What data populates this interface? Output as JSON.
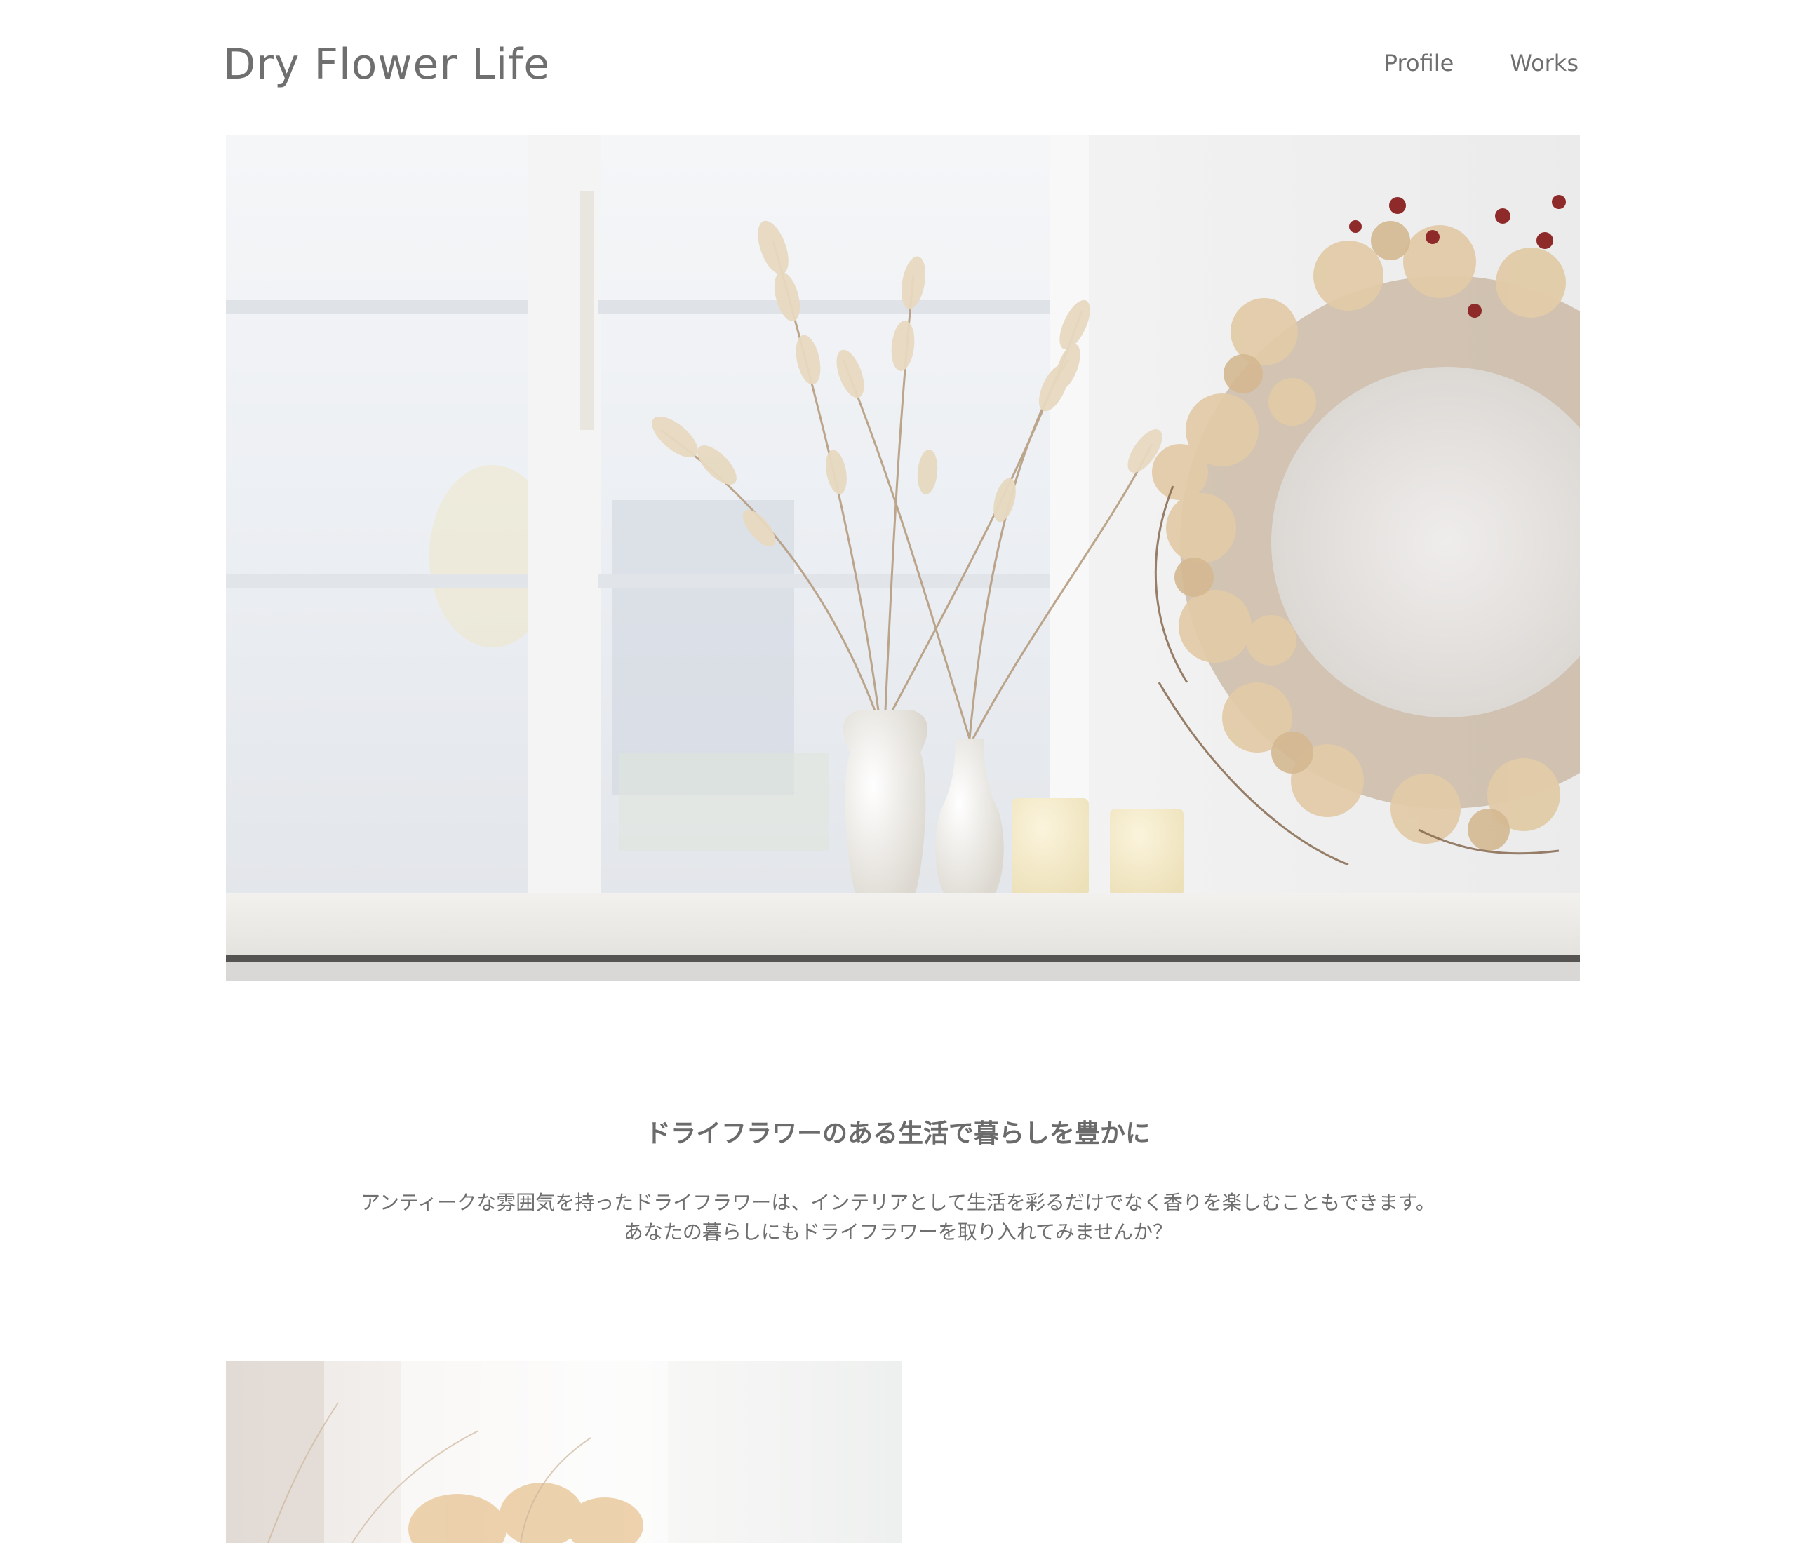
{
  "site": {
    "logo": "Dry Flower Life"
  },
  "nav": {
    "items": [
      "Profile",
      "Works"
    ]
  },
  "hero": {
    "image_description_icon": "hero-photo"
  },
  "intro": {
    "heading": "ドライフラワーのある生活で暮らしを豊かに",
    "lines": [
      "アンティークな雰囲気を持ったドライフラワーは、インテリアとして生活を彩るだけでなく香りを楽しむこともできます。",
      "あなたの暮らしにもドライフラワーを取り入れてみませんか？"
    ]
  },
  "colors": {
    "text": "#6f6f6f",
    "background": "#ffffff"
  }
}
